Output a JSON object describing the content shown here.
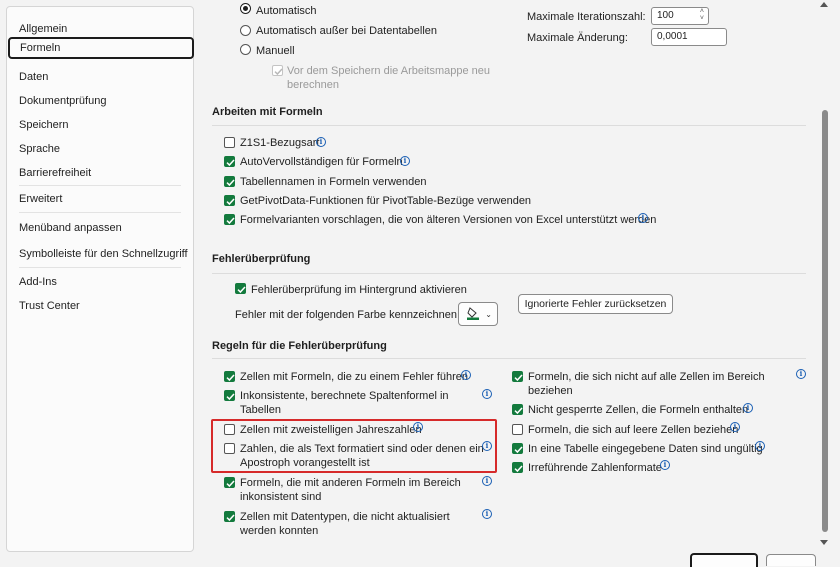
{
  "sidebar": {
    "items": [
      {
        "label": "Allgemein",
        "selected": false
      },
      {
        "label": "Formeln",
        "selected": true
      },
      {
        "label": "Daten",
        "selected": false
      },
      {
        "label": "Dokumentprüfung",
        "selected": false
      },
      {
        "label": "Speichern",
        "selected": false
      },
      {
        "label": "Sprache",
        "selected": false
      },
      {
        "label": "Barrierefreiheit",
        "selected": false
      },
      {
        "label": "Erweitert",
        "selected": false
      },
      {
        "label": "Menüband anpassen",
        "selected": false
      },
      {
        "label": "Symbolleiste für den Schnellzugriff",
        "selected": false
      },
      {
        "label": "Add-Ins",
        "selected": false
      },
      {
        "label": "Trust Center",
        "selected": false
      }
    ]
  },
  "calculation": {
    "radio_automatic": "Automatisch",
    "radio_automatic_except": "Automatisch außer bei Datentabellen",
    "radio_manual": "Manuell",
    "recalc_before_save_line1": "Vor dem Speichern die Arbeitsmappe neu",
    "recalc_before_save_line2": "berechnen",
    "max_iterations_label": "Maximale Iterationszahl:",
    "max_iterations_value": "100",
    "max_change_label": "Maximale Änderung:",
    "max_change_value": "0,0001"
  },
  "working_with_formulas": {
    "title": "Arbeiten mit Formeln",
    "r1c1": "Z1S1-Bezugsart",
    "autocomplete": "AutoVervollständigen für Formeln",
    "table_names": "Tabellennamen in Formeln verwenden",
    "getpivotdata": "GetPivotData-Funktionen für PivotTable-Bezüge verwenden",
    "formula_variants": "Formelvarianten vorschlagen, die von älteren Versionen von Excel unterstützt werden"
  },
  "error_checking": {
    "title": "Fehlerüberprüfung",
    "background_checking": "Fehlerüberprüfung im Hintergrund aktivieren",
    "color_label": "Fehler mit der folgenden Farbe kennzeichnen:",
    "reset_button": "Ignorierte Fehler zurücksetzen"
  },
  "rules": {
    "title": "Regeln für die Fehlerüberprüfung",
    "left": [
      {
        "line1": "Zellen mit Formeln, die zu einem Fehler führen",
        "line2": "",
        "checked": true
      },
      {
        "line1": "Inkonsistente, berechnete Spaltenformel in",
        "line2": "Tabellen",
        "checked": true
      },
      {
        "line1": "Zellen mit zweistelligen Jahreszahlen",
        "line2": "",
        "checked": false
      },
      {
        "line1": "Zahlen, die als Text formatiert sind oder denen ein",
        "line2": "Apostroph vorangestellt ist",
        "checked": false
      },
      {
        "line1": "Formeln, die mit anderen Formeln im Bereich",
        "line2": "inkonsistent sind",
        "checked": true
      },
      {
        "line1": "Zellen mit Datentypen, die nicht aktualisiert",
        "line2": "werden konnten",
        "checked": true
      }
    ],
    "right": [
      {
        "line1": "Formeln, die sich nicht auf alle Zellen im Bereich",
        "line2": "beziehen",
        "checked": true
      },
      {
        "line1": "Nicht gesperrte Zellen, die Formeln enthalten",
        "line2": "",
        "checked": true
      },
      {
        "line1": "Formeln, die sich auf leere Zellen beziehen",
        "line2": "",
        "checked": false
      },
      {
        "line1": "In eine Tabelle eingegebene Daten sind ungültig",
        "line2": "",
        "checked": true
      },
      {
        "line1": "Irreführende Zahlenformate",
        "line2": "",
        "checked": true
      }
    ]
  },
  "colors": {
    "accent": "#137a3d",
    "highlight": "#d62a2a",
    "info": "#1a5fb4"
  }
}
